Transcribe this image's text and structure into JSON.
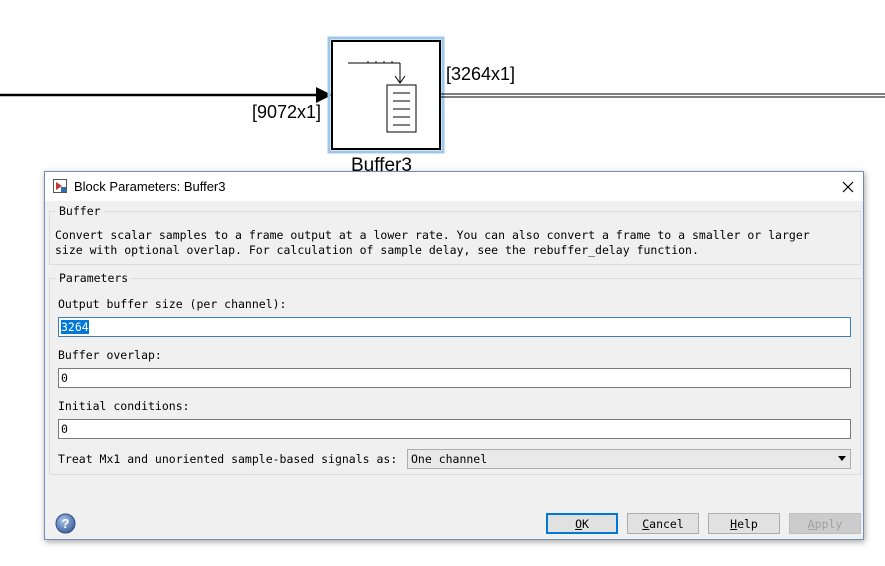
{
  "canvas": {
    "input_signal_label": "[9072x1]",
    "output_signal_label": "[3264x1]",
    "block_name": "Buffer3"
  },
  "dialog": {
    "title": "Block Parameters: Buffer3",
    "close_icon": "close-icon",
    "group_title": "Buffer",
    "description": "Convert scalar samples to a frame output at a lower rate. You can also convert a frame to a smaller or larger\nsize with optional overlap. For calculation of sample delay, see the rebuffer_delay function.",
    "parameters_title": "Parameters",
    "output_buffer_size_label": "Output buffer size (per channel):",
    "output_buffer_size_value": "3264",
    "buffer_overlap_label": "Buffer overlap:",
    "buffer_overlap_value": "0",
    "initial_conditions_label": "Initial conditions:",
    "initial_conditions_value": "0",
    "treat_label": "Treat Mx1 and unoriented sample-based signals as:",
    "treat_value": "One channel",
    "buttons": {
      "ok": "OK",
      "cancel": "Cancel",
      "help": "Help",
      "apply": "Apply"
    },
    "help_icon": "help-icon"
  },
  "colors": {
    "accent": "#0078d7",
    "block_border": "#9fc7e8",
    "dialog_background": "#f0f0f0"
  }
}
